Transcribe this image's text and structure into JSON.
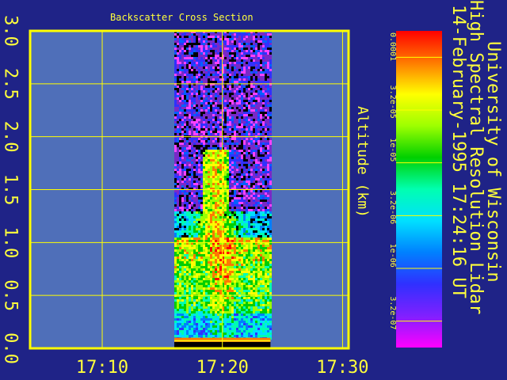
{
  "chart_data": {
    "type": "heatmap",
    "title": "Backscatter Cross Section",
    "ylabel": "Altitude (km)",
    "xlabel": "",
    "x_ticks": [
      "17:10",
      "17:20",
      "17:30"
    ],
    "y_ticks": [
      "0.0",
      "0.5",
      "1.0",
      "1.5",
      "2.0",
      "2.5",
      "3.0"
    ],
    "x_tick_values_min": [
      10,
      20,
      30
    ],
    "xlim_min": [
      4,
      30.5
    ],
    "ylim": [
      0.0,
      3.0
    ],
    "data_coverage_min": [
      16,
      24
    ],
    "grid": true,
    "colorbar": {
      "ticks": [
        "0.0001",
        "3.2e-05",
        "1e-05",
        "3.2e-06",
        "1e-06",
        "3.2e-07"
      ],
      "scale": "log",
      "colors": [
        "#ff0000",
        "#ff7a00",
        "#ffff00",
        "#9dff00",
        "#00d000",
        "#00ffb0",
        "#00e0ff",
        "#0080ff",
        "#3030ff",
        "#8020ff",
        "#ff00ff"
      ]
    },
    "annotations": [
      "University of Wisconsin",
      "High Spectral Resolution Lidar",
      "14-February-1995 17:24:16 UT"
    ]
  },
  "colors": {
    "background": "#1f2387",
    "plot_area": "#4f6fb9",
    "frame": "#ffff00",
    "text": "#ffff3c"
  }
}
